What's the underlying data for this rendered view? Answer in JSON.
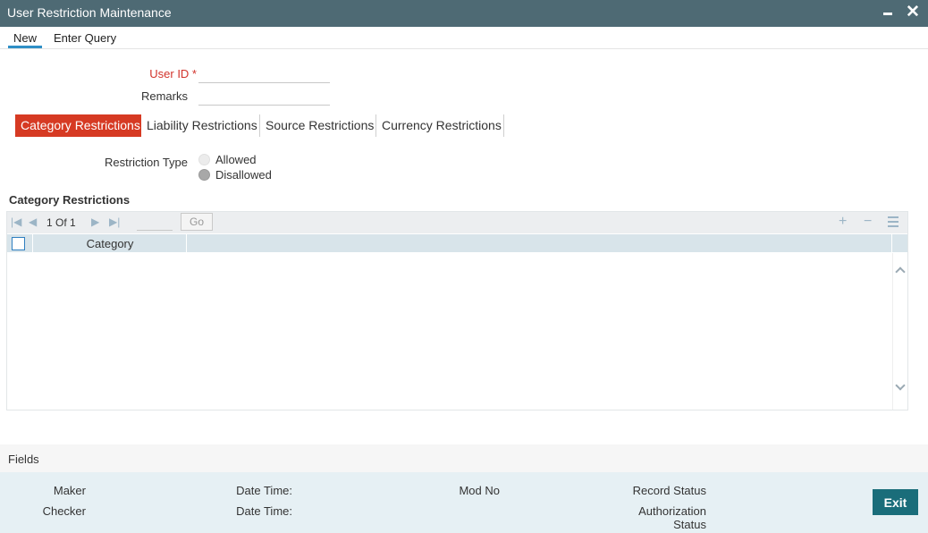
{
  "window": {
    "title": "User Restriction Maintenance"
  },
  "menu": {
    "new_label": "New",
    "query_label": "Enter Query"
  },
  "form": {
    "user_id_label": "User ID *",
    "user_id_value": "",
    "remarks_label": "Remarks",
    "remarks_value": ""
  },
  "tabs": [
    {
      "label": "Category Restrictions",
      "active": true
    },
    {
      "label": "Liability Restrictions",
      "active": false
    },
    {
      "label": "Source Restrictions",
      "active": false
    },
    {
      "label": "Currency Restrictions",
      "active": false
    }
  ],
  "restriction": {
    "type_label": "Restriction Type",
    "options": [
      {
        "label": "Allowed",
        "selected": false
      },
      {
        "label": "Disallowed",
        "selected": true
      }
    ]
  },
  "grid": {
    "title": "Category Restrictions",
    "page_current": "1",
    "page_of": "Of",
    "page_total": "1",
    "go_label": "Go",
    "columns": [
      "Category"
    ],
    "rows": []
  },
  "fields_label": "Fields",
  "footer": {
    "maker": "Maker",
    "checker": "Checker",
    "date_time_1": "Date Time:",
    "date_time_2": "Date Time:",
    "mod_no": "Mod No",
    "record_status": "Record Status",
    "authorization_status": "Authorization Status",
    "exit_label": "Exit"
  },
  "colors": {
    "titlebar": "#4e6a74",
    "active_tab": "#d63a23",
    "required_label": "#d2332b",
    "exit_button": "#1a6d7a",
    "footer_bg": "#e6f0f4"
  }
}
